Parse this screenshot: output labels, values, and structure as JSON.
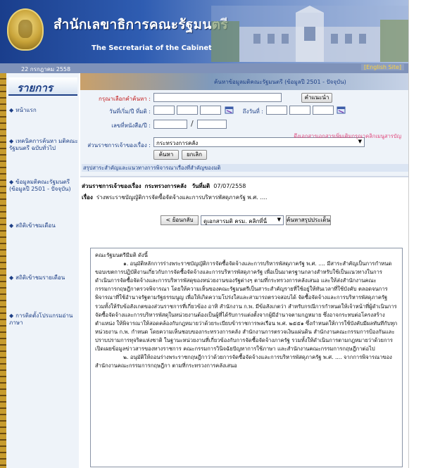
{
  "header": {
    "title_th": "สำนักเลขาธิการคณะรัฐมนตรี",
    "title_en": "The Secretariat of the Cabinet",
    "date": "22 กรกฎาคม 2558",
    "english_link": "[English Site]"
  },
  "sidebar": {
    "heading": "รายการ",
    "items": [
      {
        "label": "หน้าแรก"
      },
      {
        "label": "เทคนิคการค้นหา มติคณะรัฐมนตรี ฉบับทั่วไป"
      },
      {
        "label": "ข้อมูลมติคณะรัฐมนตรี (ข้อมูลปี 2501 - ปัจจุบัน)"
      },
      {
        "label": "สถิติเข้าชมเดือน"
      },
      {
        "label": "สถิติเข้าชมรายเดือน"
      },
      {
        "label": "การติดตั้งโปรแกรมอ่านภาษา"
      }
    ]
  },
  "banner": {
    "title": "ค้นหาข้อมูลมติคณะรัฐมนตรี (ข้อมูลปี 2501 - ปัจจุบัน)"
  },
  "form": {
    "keyword_label": "กรุณาเลือกคำค้นหา :",
    "keyword_value": "",
    "keyword_button": "คำแนะนำ",
    "date_from_label": "วันที่เริ่ม/ปี ที่มติ :",
    "date_to_label": "ถึงวันที่ :",
    "book_no_label": "เลขที่หนังสือ/ปี :",
    "agency_label": "ส่วนราชการเจ้าของเรื่อง :",
    "agency_value": "กระทรวงการคลัง",
    "search_button": "ค้นหา",
    "cancel_button": "ยกเลิก"
  },
  "result": {
    "agency_line_label": "ส่วนราชการเจ้าของเรื่อง",
    "agency_line_value": "กระทรวงการคลัง",
    "date_label": "วันที่มติ",
    "date_value": "07/07/2558",
    "subject_label": "เรื่อง",
    "subject_value": "ร่างพระราชบัญญัติการจัดซื้อจัดจ้างและการบริหารพัสดุภาครัฐ พ.ศ. ....",
    "pink_note": "ดึงเอกสารเอกสารเพิ่มเติมกรุณาคลิกเมนูสารบัญ",
    "back_button": "< ย้อนกลับ",
    "doc_select": "ดูเอกสารมติ ครม. คลิกที่นี่",
    "summary_button": "ค้นหาสรุปประเด็น",
    "summary_heading": "สรุปสาระสำคัญและแนวทางการพิจารณาเรื่องที่สำคัญของมติ",
    "text_intro": "คณะรัฐมนตรีมีมติ ดังนี้",
    "text_p1": "๑. อนุมัติหลักการร่างพระราชบัญญัติการจัดซื้อจัดจ้างและการบริหารพัสดุภาครัฐ พ.ศ. .... มีสาระสำคัญเป็นการกำหนดขอบเขตการปฏิบัติงานเกี่ยวกับการจัดซื้อจัดจ้างและการบริหารพัสดุภาครัฐ เพื่อเป็นมาตรฐานกลางสำหรับใช้เป็นแนวทางในการดำเนินการจัดซื้อจัดจ้างและการบริหารพัสดุของหน่วยงานของรัฐต่างๆ ตามที่กระทรวงการคลังเสนอ และให้ส่งสำนักงานคณะกรรมการกฤษฎีกาตรวจพิจารณา โดยให้ความเห็นของคณะรัฐมนตรีเป็นสาระสำคัญรายที่ใช้อยู่ให้ทันเวลาที่ใช้บังคับ ตลอดจนการพิจารณาที่ใช้อำนาจรัฐตามรัฐธรรมนูญ เพื่อให้เกิดความโปร่งใสและสามารถตรวจสอบได้ จัดซื้อจัดจ้างและการบริหารพัสดุภาครัฐ รวมทั้งให้รับข้อสังเกตของส่วนราชการที่เกี่ยวข้อง อาทิ สำนักงาน ก.พ. มีข้อสังเกตว่า สำหรับกรณีการกำหนดให้เจ้าหน้าที่ผู้ดำเนินการจัดซื้อจัดจ้างและการบริหารพัสดุในหน่วยงานต้องเป็นผู้ที่ได้รับการแต่งตั้งจากผู้มีอำนาจตามกฎหมาย ซึ่งอาจกระทบต่อโครงสร้างตำแหน่ง ให้พิจารณาให้สอดคล้องกับกฎหมายว่าด้วยระเบียบข้าราชการพลเรือน พ.ศ. ๒๕๕๑ ซึ่งกำหนดให้การใช้บังคับมีผลทันทีกับทุกหน่วยงาน ก.พ. กำหนด โดยความเห็นชอบของกระทรวงการคลัง สำนักงานการตรวจเงินแผ่นดิน สำนักงานคณะกรรมการป้องกันและปราบปรามการทุจริตแห่งชาติ ในฐานะหน่วยงานที่เกี่ยวข้องกับการจัดซื้อจัดจ้างภาครัฐ รวมทั้งให้ดำเนินการตามกฎหมายว่าด้วยการเปิดเผยข้อมูลข่าวสารของทางราชการ คณะกรรมการวินิจฉัยปัญหาการใช้ภาษา และสำนักงานคณะกรรมการกฤษฎีกาต่อไป",
    "text_p2": "๒. อนุมัติให้ถอนร่างพระราชกฤษฎีกาว่าด้วยการจัดซื้อจัดจ้างและการบริหารพัสดุภาครัฐ พ.ศ. .... จากการพิจารณาของสำนักงานคณะกรรมการกฤษฎีกา ตามที่กระทรวงการคลังเสนอ"
  }
}
